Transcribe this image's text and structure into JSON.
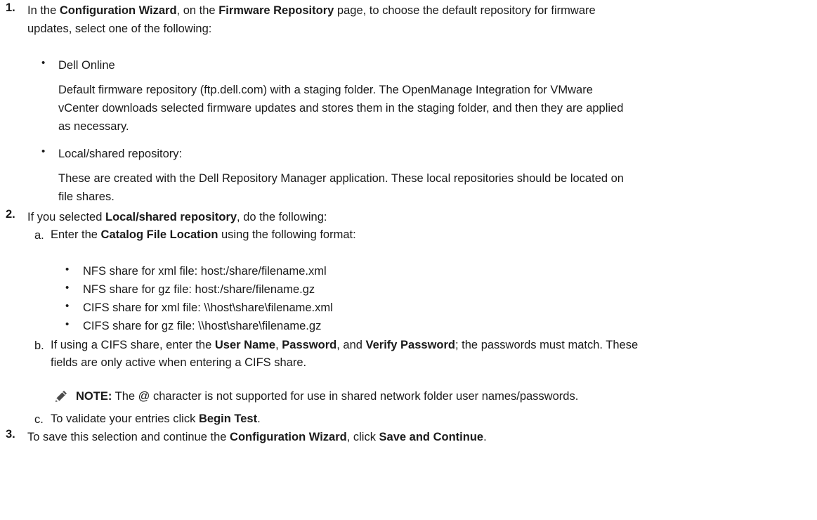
{
  "step1": {
    "number": "1.",
    "line1_pre": "In the ",
    "line1_b1": "Configuration Wizard",
    "line1_mid": ", on the ",
    "line1_b2": "Firmware Repository",
    "line1_post": " page, to choose the default repository for firmware",
    "line2": "updates, select one of the following:",
    "options": [
      {
        "bullet": "•",
        "title": "Dell Online",
        "desc_lines": [
          "Default firmware repository (ftp.dell.com) with a staging folder. The OpenManage Integration for VMware",
          "vCenter downloads selected firmware updates and stores them in the staging folder, and then they are applied",
          "as necessary."
        ]
      },
      {
        "bullet": "•",
        "title": "Local/shared repository:",
        "desc_lines": [
          "These are created with the Dell Repository Manager application. These local repositories should be located on",
          "file shares."
        ]
      }
    ]
  },
  "step2": {
    "number": "2.",
    "pre": "If you selected ",
    "bold": "Local/shared repository",
    "post": ", do the following:",
    "a": {
      "marker": "a.",
      "pre": "Enter the ",
      "bold": "Catalog File Location",
      "post": " using the following format:",
      "formats": [
        "NFS share for xml file: host:/share/filename.xml",
        "NFS share for gz file: host:/share/filename.gz",
        "CIFS share for xml file: \\\\host\\share\\filename.xml",
        "CIFS share for gz file: \\\\host\\share\\filename.gz"
      ]
    },
    "b": {
      "marker": "b.",
      "pre": "If using a CIFS share, enter the ",
      "bold1": "User Name",
      "sep1": ", ",
      "bold2": "Password",
      "sep2": ", and ",
      "bold3": "Verify Password",
      "post": "; the passwords must match. These",
      "line2": "fields are only active when entering a CIFS share.",
      "note_label": "NOTE:",
      "note_text": " The @ character is not supported for use in shared network folder user names/passwords."
    },
    "c": {
      "marker": "c.",
      "pre": "To validate your entries click ",
      "bold": "Begin Test",
      "post": "."
    }
  },
  "step3": {
    "number": "3.",
    "pre": "To save this selection and continue the ",
    "bold1": "Configuration Wizard",
    "mid": ", click ",
    "bold2": "Save and Continue",
    "post": "."
  },
  "icons": {
    "note": "pencil-note-icon"
  }
}
